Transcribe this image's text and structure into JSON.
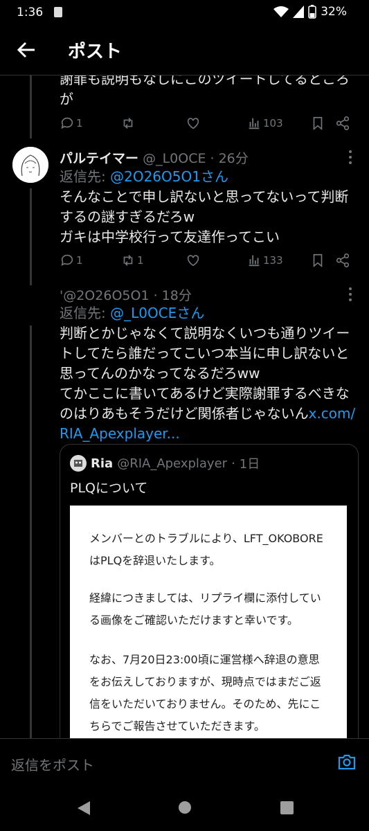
{
  "status": {
    "time": "1:36",
    "battery": "32%"
  },
  "header": {
    "title": "ポスト"
  },
  "prev_post": {
    "text_line1": "謝罪も説明もなしにこのツイートしてるところ",
    "text_line2": "が",
    "replies": "1",
    "retweets": "",
    "views": "103"
  },
  "post1": {
    "name": "パルテイマー",
    "handle": "@_L0OCE",
    "time": "26分",
    "reply_to_label": "返信先:",
    "reply_to_handle": "@2O26O5O1さん",
    "lines": [
      "そんなことで申し訳ないと思ってないって判断",
      "するの謎すぎるだろw",
      "ガキは中学校行って友達作ってこい"
    ],
    "replies": "1",
    "retweets": "1",
    "views": "133"
  },
  "post2": {
    "handle": "'@2O26O5O1",
    "time": "18分",
    "reply_to_label": "返信先:",
    "reply_to_handle": "@_L0OCEさん",
    "lines": [
      "判断とかじゃなくて説明なくいつも通りツイー",
      "トしてたら誰だってこいつ本当に申し訳ないと",
      "思ってんのかなってなるだろww",
      "てかここに書いてあるけど実際謝罪するべきな"
    ],
    "line5_text": "のはりあもそうだけど関係者じゃないん",
    "line5_link": "x.com/",
    "line6_link": "RIA_Apexplayer..."
  },
  "quote": {
    "name": "Ria",
    "handle": "@RIA_Apexplayer",
    "time": "1日",
    "title": "PLQについて",
    "image_lines": [
      "メンバーとのトラブルにより、LFT_OKOBORE",
      "はPLQを辞退いたします。",
      "経緯につきましては、リプライ欄に添付してい",
      "る画像をご確認いただけますと幸いです。",
      "なお、7月20日23:00頃に運営様へ辞退の意思",
      "をお伝えしておりますが、現時点ではまだご返",
      "信をいただいておりません。そのため、先にこ",
      "ちらでご報告させていただきます。"
    ]
  },
  "reply_bar": {
    "placeholder": "返信をポスト"
  }
}
